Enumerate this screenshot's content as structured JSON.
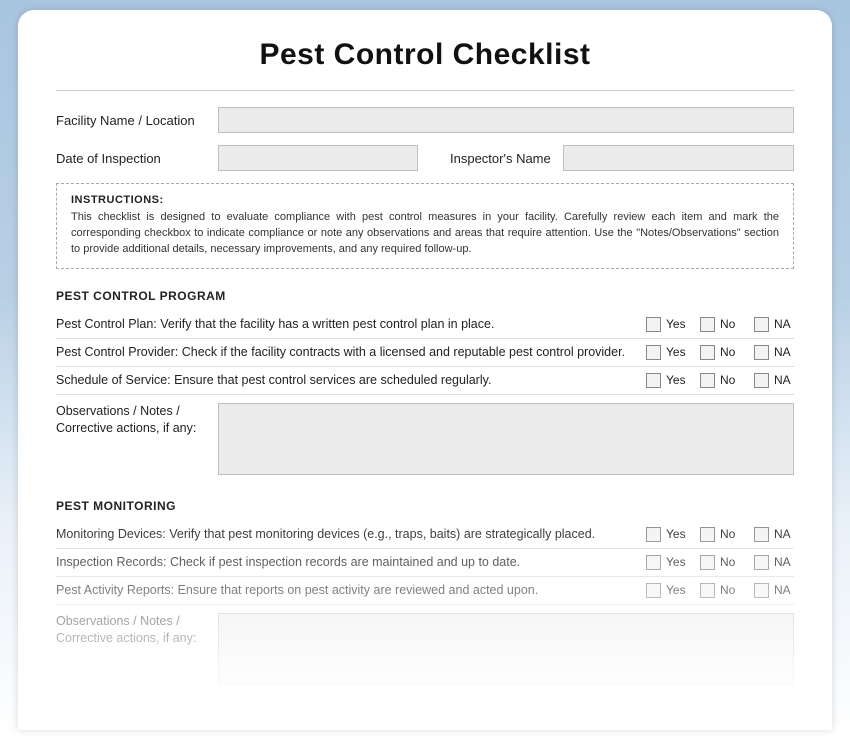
{
  "title": "Pest Control Checklist",
  "fields": {
    "facility_label": "Facility Name / Location",
    "date_label": "Date of Inspection",
    "inspector_label": "Inspector's Name"
  },
  "instructions": {
    "heading": "INSTRUCTIONS:",
    "body": "This checklist is designed to evaluate compliance with pest control measures in your facility. Carefully review each item and mark the corresponding checkbox to indicate compliance or note any observations and areas that require attention. Use the \"Notes/Observations\" section to provide additional details, necessary improvements, and any required follow-up."
  },
  "options": {
    "yes": "Yes",
    "no": "No",
    "na": "NA"
  },
  "notes_label": "Observations / Notes / Corrective actions, if any:",
  "sections": [
    {
      "header": "PEST CONTROL PROGRAM",
      "items": [
        "Pest Control Plan: Verify that the facility has a written pest control plan in place.",
        "Pest Control Provider: Check if the facility contracts with a licensed and reputable pest control provider.",
        "Schedule of Service: Ensure that pest control services are scheduled regularly."
      ]
    },
    {
      "header": "PEST MONITORING",
      "items": [
        "Monitoring Devices: Verify that pest monitoring devices (e.g., traps, baits) are strategically placed.",
        "Inspection Records: Check if pest inspection records are maintained and up to date.",
        "Pest Activity Reports: Ensure that reports on pest activity are reviewed and acted upon."
      ]
    }
  ]
}
